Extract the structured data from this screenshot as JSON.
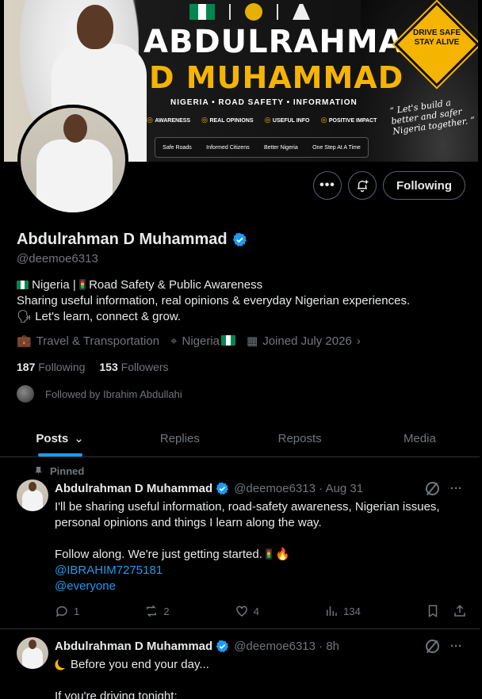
{
  "banner": {
    "title_line1": "ABDULRAHMAN",
    "title_line2": "D MUHAMMAD",
    "subtitle": "NIGERIA • ROAD SAFETY • INFORMATION",
    "pills": [
      "AWARENESS",
      "REAL OPINIONS",
      "USEFUL INFO",
      "POSITIVE IMPACT"
    ],
    "strip": [
      "Safe Roads",
      "Informed Citizens",
      "Better Nigeria",
      "One Step At A Time"
    ],
    "sign_text": "DRIVE SAFE STAY ALIVE",
    "quote": "“ Let's build a better and safer Nigeria together. ”"
  },
  "actions": {
    "more_icon": "more-icon",
    "notify_icon": "bell-plus-icon",
    "follow_label": "Following"
  },
  "profile": {
    "name": "Abdulrahman D Muhammad",
    "handle": "@deemoe6313",
    "bio_line1": " Nigeria | ",
    "bio_line1b": " Road Safety & Public Awareness",
    "bio_line2": "Sharing useful information, real opinions & everyday Nigerian experiences.",
    "bio_line3": "🗣 Let's learn, connect & grow.",
    "category": "Travel & Transportation",
    "location": "Nigeria",
    "joined": "Joined July 2026",
    "following_count": "187",
    "following_label": "Following",
    "followers_count": "153",
    "followers_label": "Followers",
    "followed_by": "Followed by Ibrahim Abdullahi"
  },
  "tabs": [
    "Posts",
    "Replies",
    "Reposts",
    "Media"
  ],
  "posts": [
    {
      "pinned_label": "Pinned",
      "name": "Abdulrahman D Muhammad",
      "handle_time": "@deemoe6313 · Aug 31",
      "text1": "I'll be sharing useful information, road-safety awareness, Nigerian issues, personal opinions and things I learn along the way.",
      "text2": "Follow along. We're just getting started. ",
      "mention1": "@IBRAHIM7275181",
      "mention2": "@everyone",
      "replies": "1",
      "reposts": "2",
      "likes": "4",
      "views": "134"
    },
    {
      "name": "Abdulrahman D Muhammad",
      "handle_time": "@deemoe6313 · 8h",
      "text1": "Before you end your day...",
      "text2": "If you're driving tonight:"
    }
  ],
  "colors": {
    "accent": "#1d9bf0",
    "muted": "#71767b",
    "border": "#2f3336",
    "banner_gold": "#f5b400"
  }
}
